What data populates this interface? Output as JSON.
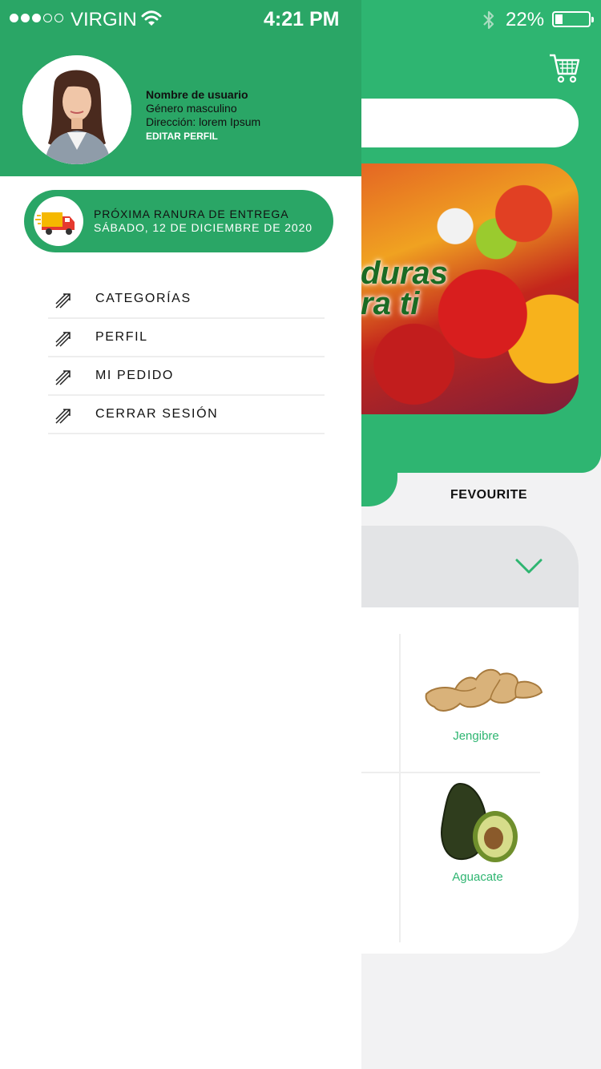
{
  "status_bar": {
    "carrier": "VIRGIN",
    "time": "4:21 PM",
    "battery": "22%"
  },
  "background_app": {
    "banner_text_line1": "duras",
    "banner_text_line2": "ra ti",
    "tab_label": "FEVOURITE",
    "products": [
      {
        "name": "Jengibre",
        "icon": "ginger-icon"
      },
      {
        "name": "Aguacate",
        "icon": "avocado-icon"
      }
    ]
  },
  "drawer": {
    "user": {
      "name": "Nombre de usuario",
      "gender": "Género masculino",
      "address": "Dirección: lorem Ipsum",
      "edit_label": "EDITAR PERFIL"
    },
    "delivery": {
      "label": "PRÓXIMA RANURA DE ENTREGA",
      "date": "SÁBADO, 12 DE DICIEMBRE DE 2020"
    },
    "menu": [
      {
        "label": "CATEGORÍAS"
      },
      {
        "label": "PERFIL"
      },
      {
        "label": "MI PEDIDO"
      },
      {
        "label": "CERRAR SESIÓN"
      }
    ]
  },
  "colors": {
    "primary_green": "#2eb571",
    "drawer_green": "#2aa666",
    "product_text": "#2eb571"
  }
}
